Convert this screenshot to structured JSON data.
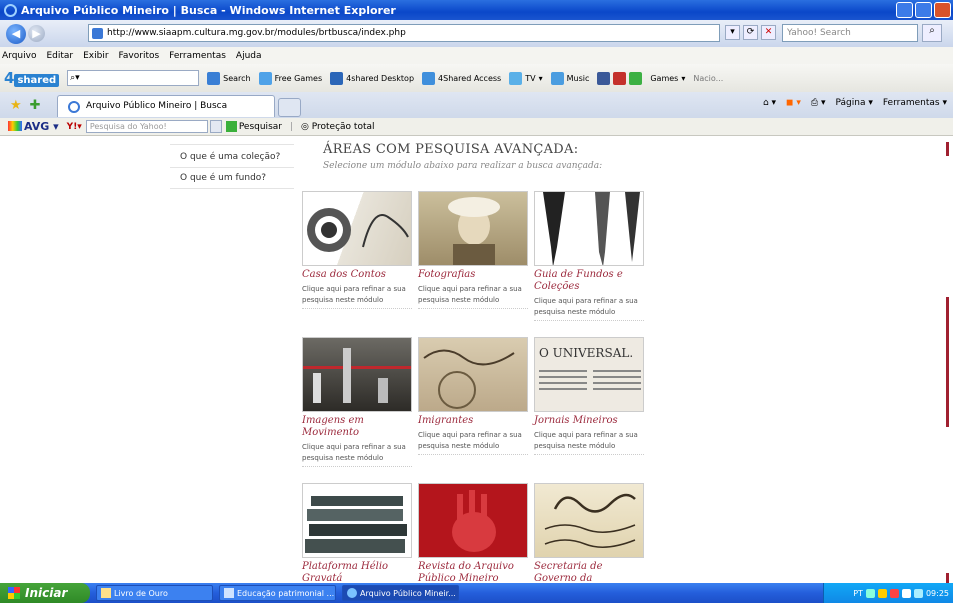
{
  "window": {
    "title": "Arquivo Público Mineiro | Busca - Windows Internet Explorer"
  },
  "address": {
    "url": "http://www.siaapm.cultura.mg.gov.br/modules/brtbusca/index.php",
    "search_placeholder": "Yahoo! Search"
  },
  "menu": {
    "items": [
      "Arquivo",
      "Editar",
      "Exibir",
      "Favoritos",
      "Ferramentas",
      "Ajuda"
    ]
  },
  "toolbar": {
    "logo_num": "4",
    "logo_text": "shared",
    "items": [
      "Search",
      "Free Games",
      "4shared Desktop",
      "4Shared Access",
      "TV",
      "Music",
      "Games",
      "Nacio..."
    ]
  },
  "tabs": {
    "active_label": "Arquivo Público Mineiro | Busca",
    "page_menu": "Página",
    "tools_menu": "Ferramentas"
  },
  "avg": {
    "brand": "AVG",
    "search_placeholder": "Pesquisa do Yahoo!",
    "search_label": "Pesquisar",
    "protection": "Proteção total"
  },
  "sidebar": {
    "links": [
      "O que é uma coleção?",
      "O que é um fundo?"
    ]
  },
  "main": {
    "heading": "ÁREAS COM PESQUISA AVANÇADA:",
    "subheading": "Selecione um módulo abaixo para realizar a busca avançada:",
    "modules": [
      {
        "title": "Casa dos Contos",
        "desc": "Clique aqui para refinar a sua pesquisa neste módulo"
      },
      {
        "title": "Fotografias",
        "desc": "Clique aqui para refinar a sua pesquisa neste módulo"
      },
      {
        "title": "Guia de Fundos e Coleções",
        "desc": "Clique aqui para refinar a sua pesquisa neste módulo"
      },
      {
        "title": "Imagens em Movimento",
        "desc": "Clique aqui para refinar a sua pesquisa neste módulo"
      },
      {
        "title": "Imigrantes",
        "desc": "Clique aqui para refinar a sua pesquisa neste módulo"
      },
      {
        "title": "Jornais Mineiros",
        "desc": "Clique aqui para refinar a sua pesquisa neste módulo"
      },
      {
        "title": "Plataforma Hélio Gravatá",
        "desc": ""
      },
      {
        "title": "Revista do Arquivo Público Mineiro",
        "desc": ""
      },
      {
        "title": "Secretaria de Governo da Capitania",
        "desc": ""
      }
    ],
    "image_texts": {
      "jornal": "O UNIVERSAL."
    }
  },
  "taskbar": {
    "start": "Iniciar",
    "tasks": [
      "Livro de Ouro",
      "Educação patrimonial ...",
      "Arquivo Público Mineir..."
    ],
    "lang": "PT",
    "clock": "09:25"
  }
}
